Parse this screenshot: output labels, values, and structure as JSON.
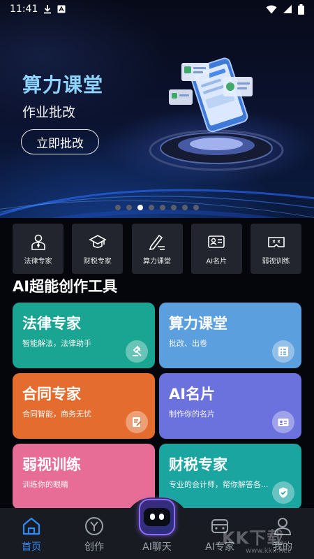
{
  "status_bar": {
    "time": "11:41"
  },
  "banner": {
    "title": "算力课堂",
    "subtitle": "作业批改",
    "button_label": "立即批改",
    "dots_count": 8,
    "active_dot": 2
  },
  "shortcuts": [
    {
      "label": "法律专家",
      "icon": "lawyer-icon"
    },
    {
      "label": "财税专家",
      "icon": "graduation-cap-icon"
    },
    {
      "label": "算力课堂",
      "icon": "pen-icon"
    },
    {
      "label": "AI名片",
      "icon": "id-card-icon"
    },
    {
      "label": "弱视训练",
      "icon": "vr-glasses-icon"
    }
  ],
  "section": {
    "title": "AI超能创作工具"
  },
  "cards": [
    {
      "title": "法律专家",
      "desc": "智能解法，法律助手",
      "color": "#1aa592",
      "icon": "gavel-icon"
    },
    {
      "title": "算力课堂",
      "desc": "批改、出卷",
      "color": "#5b9fde",
      "icon": "form-icon"
    },
    {
      "title": "合同专家",
      "desc": "合同智能，商务无忧",
      "color": "#e36c2e",
      "icon": "contract-icon"
    },
    {
      "title": "AI名片",
      "desc": "制作你的名片",
      "color": "#6c72dd",
      "icon": "id-card-icon"
    },
    {
      "title": "弱视训练",
      "desc": "训练你的眼睛",
      "color": "#e86d96",
      "icon": "eye-icon"
    },
    {
      "title": "财税专家",
      "desc": "专业的会计师，帮你解答各...",
      "color": "#1aa5a0",
      "icon": "shield-icon"
    }
  ],
  "bottom_nav": [
    {
      "label": "首页",
      "icon": "home-icon",
      "active": true
    },
    {
      "label": "创作",
      "icon": "create-icon",
      "active": false
    },
    {
      "label": "AI聊天",
      "icon": "robot-icon",
      "active": false
    },
    {
      "label": "AI专家",
      "icon": "expert-icon",
      "active": false
    },
    {
      "label": "我的",
      "icon": "profile-icon",
      "active": false
    }
  ],
  "colors": {
    "accent": "#2f8cff",
    "banner_title": "#8fd4ff"
  },
  "watermark": {
    "text": "KK下载",
    "url": "www.kkx.net"
  }
}
